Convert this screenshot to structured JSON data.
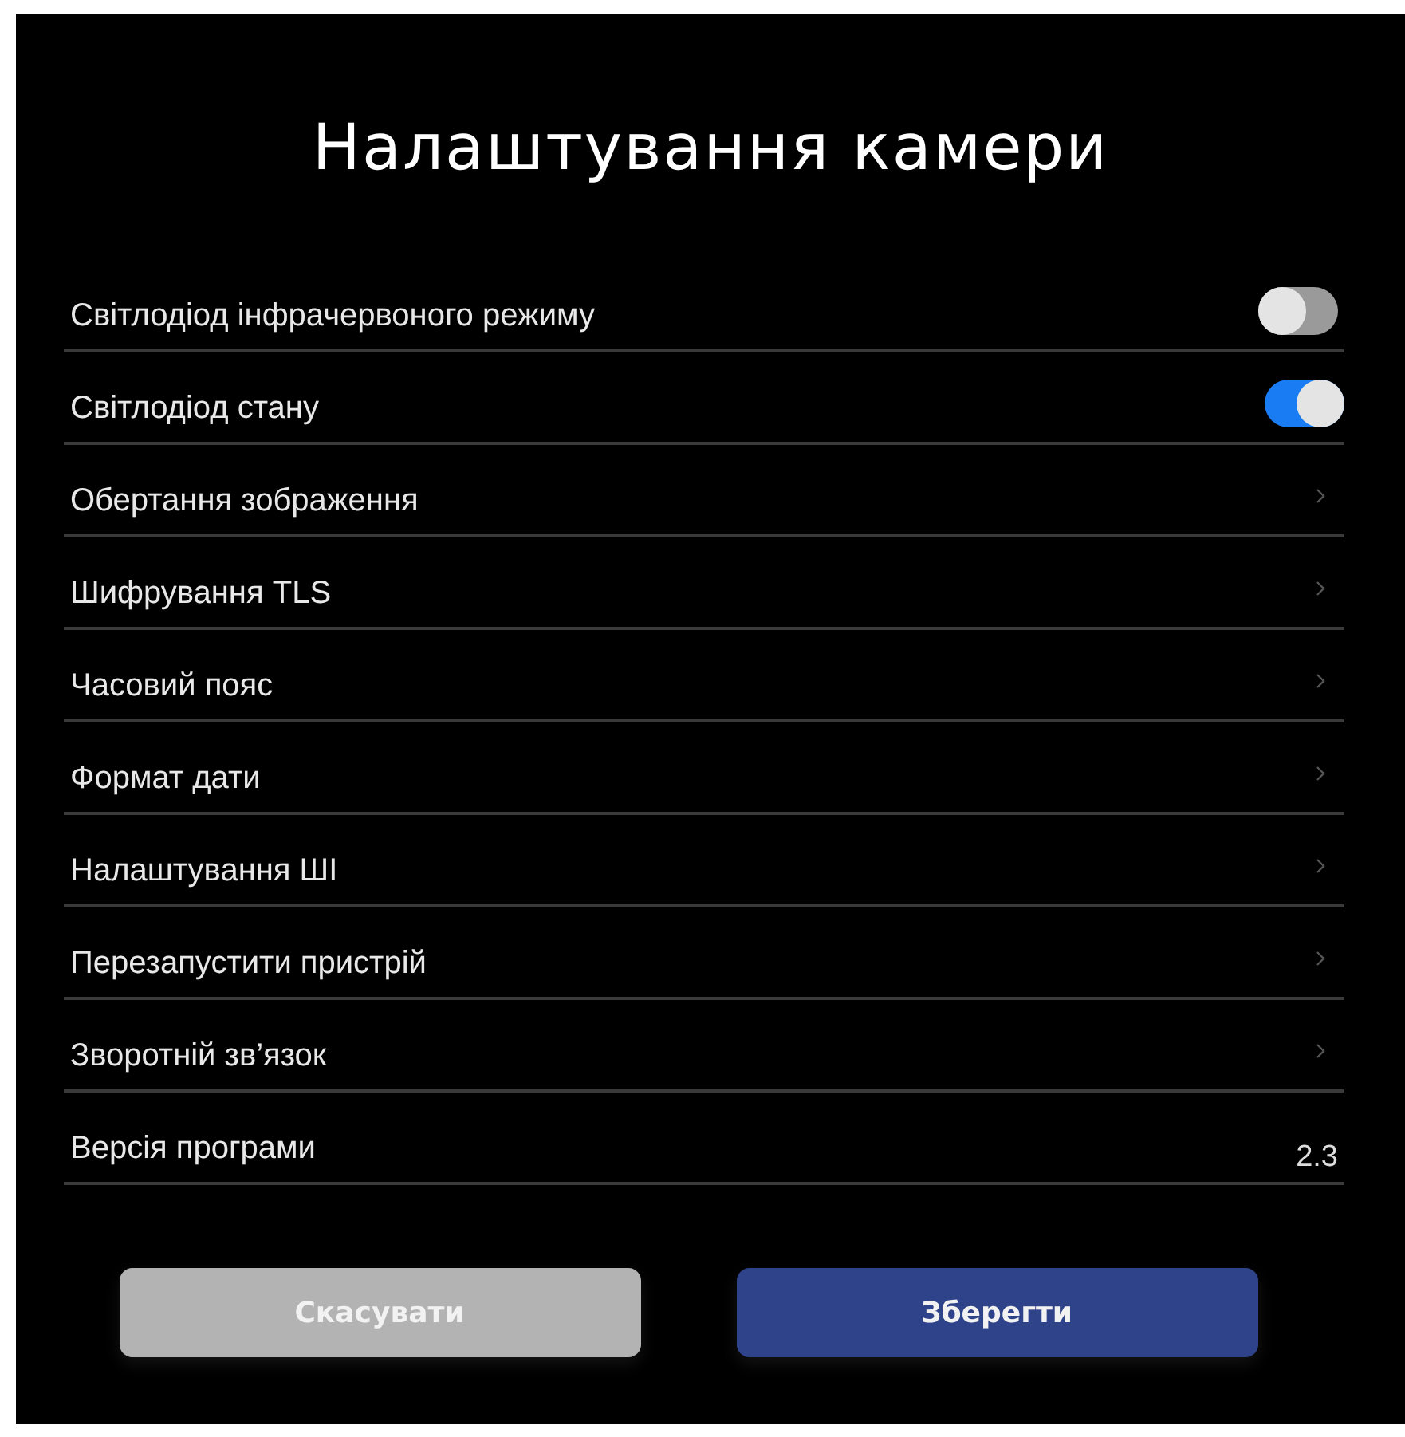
{
  "title": "Налаштування камери",
  "settings": [
    {
      "kind": "toggle",
      "label": "Світлодіод інфрачервоного режиму",
      "on": false
    },
    {
      "kind": "toggle",
      "label": "Світлодіод стану",
      "on": true
    },
    {
      "kind": "link",
      "label": "Обертання зображення"
    },
    {
      "kind": "link",
      "label": "Шифрування TLS"
    },
    {
      "kind": "link",
      "label": "Часовий пояс"
    },
    {
      "kind": "link",
      "label": "Формат дати"
    },
    {
      "kind": "link",
      "label": "Налаштування ШІ"
    },
    {
      "kind": "link",
      "label": "Перезапустити пристрій"
    },
    {
      "kind": "link",
      "label": "Зворотній зв’язок"
    },
    {
      "kind": "value",
      "label": "Версія програми",
      "value": "2.3"
    }
  ],
  "buttons": [
    {
      "kind": "cancel",
      "label": "Скасувати"
    },
    {
      "kind": "primary",
      "label": "Зберегти"
    }
  ]
}
